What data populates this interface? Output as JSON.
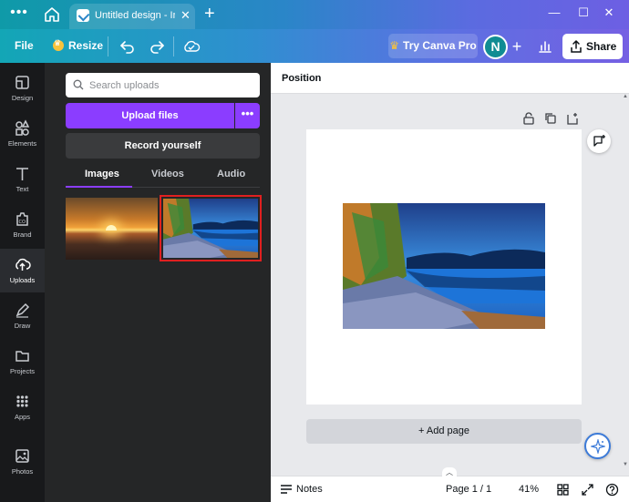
{
  "titlebar": {
    "tab_title": "Untitled design - In…",
    "tab_close": "✕",
    "new_tab": "+",
    "minimize": "—",
    "maximize": "☐",
    "close": "✕"
  },
  "toolbar": {
    "file_label": "File",
    "resize_label": "Resize",
    "try_pro_label": "Try Canva Pro",
    "avatar_initial": "N",
    "add_member": "+",
    "share_label": "Share"
  },
  "rail": {
    "items": [
      {
        "label": "Design",
        "icon": "design-icon"
      },
      {
        "label": "Elements",
        "icon": "elements-icon"
      },
      {
        "label": "Text",
        "icon": "text-icon"
      },
      {
        "label": "Brand",
        "icon": "brand-icon"
      },
      {
        "label": "Uploads",
        "icon": "uploads-icon"
      },
      {
        "label": "Draw",
        "icon": "draw-icon"
      },
      {
        "label": "Projects",
        "icon": "projects-icon"
      },
      {
        "label": "Apps",
        "icon": "apps-icon"
      },
      {
        "label": "Photos",
        "icon": "photos-icon"
      }
    ],
    "active": "Uploads"
  },
  "panel": {
    "search_placeholder": "Search uploads",
    "upload_label": "Upload files",
    "upload_more": "•••",
    "record_label": "Record yourself",
    "tabs": [
      {
        "label": "Images"
      },
      {
        "label": "Videos"
      },
      {
        "label": "Audio"
      }
    ],
    "active_tab": "Images"
  },
  "editor": {
    "position_label": "Position",
    "add_page_label": "+ Add page"
  },
  "bottombar": {
    "notes_label": "Notes",
    "page_count": "Page 1 / 1",
    "zoom": "41%"
  },
  "colors": {
    "accent_purple": "#8b3dff",
    "selection_red": "#e02020",
    "share_bg": "#ffffff"
  }
}
